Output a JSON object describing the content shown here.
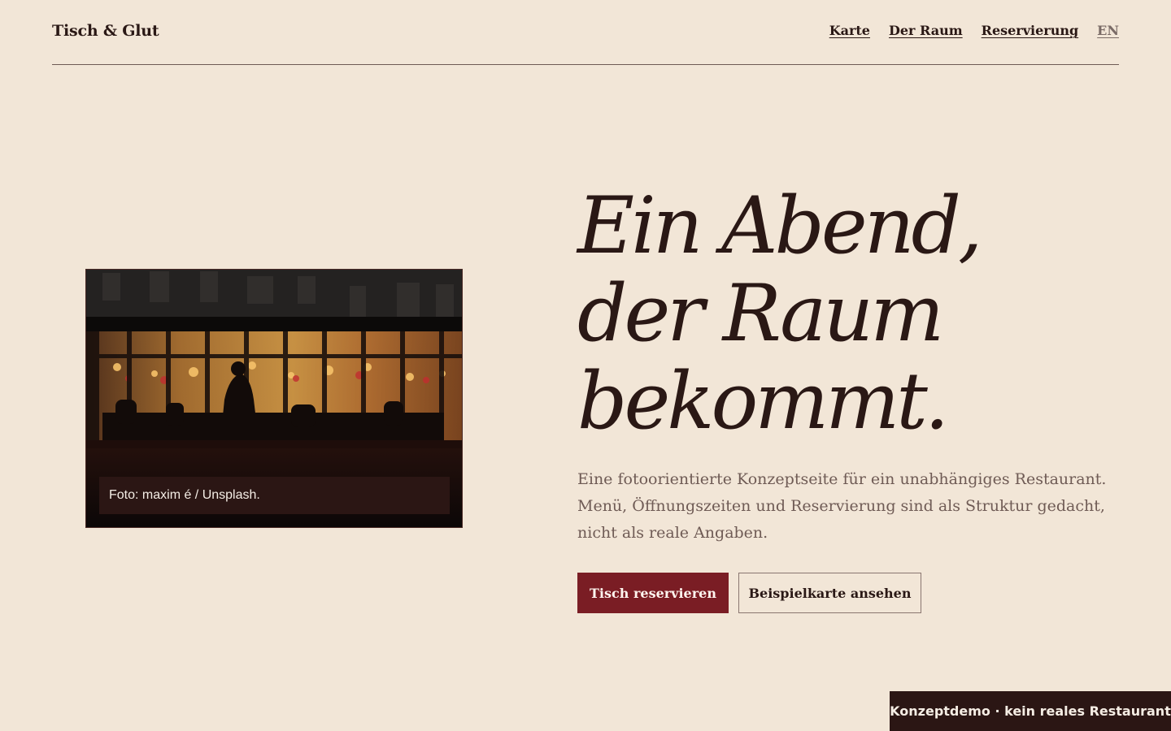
{
  "header": {
    "brand": "Tisch & Glut",
    "nav": [
      "Karte",
      "Der Raum",
      "Reservierung"
    ],
    "language": "EN"
  },
  "hero": {
    "title_lines": [
      "Ein Abend,",
      "der Raum",
      "bekommt."
    ],
    "description": "Eine fotoorientierte Konzeptseite für ein unabhängiges Restaurant. Menü, Öffnungszeiten und Reservierung sind als Struktur gedacht, nicht als reale Angaben.",
    "primary_button": "Tisch reservieren",
    "secondary_button": "Beispielkarte ansehen"
  },
  "photo": {
    "caption": "Foto: maxim é / Unsplash."
  },
  "badge": "Konzeptdemo · kein reales Restaurant",
  "colors": {
    "background": "#f2e6d7",
    "text_dark": "#2a1815",
    "accent": "#7a1d24",
    "muted_text": "#6f5b55",
    "badge_bg": "#2b1614"
  }
}
